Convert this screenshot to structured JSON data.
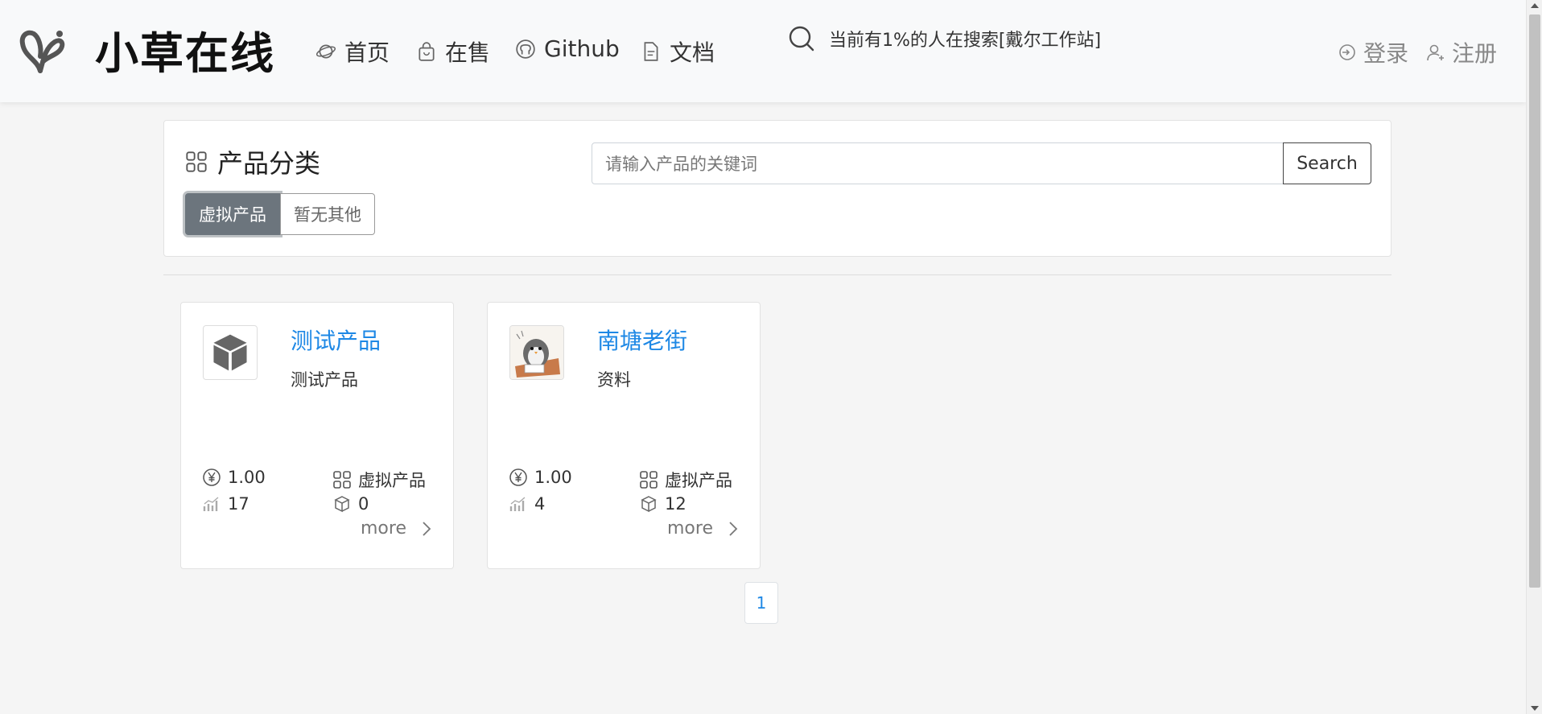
{
  "header": {
    "logo_text": "小草在线",
    "nav": [
      {
        "label": "首页",
        "icon": "planet-icon"
      },
      {
        "label": "在售",
        "icon": "bag-icon"
      },
      {
        "label": "Github",
        "icon": "github-icon"
      },
      {
        "label": "文档",
        "icon": "document-icon"
      }
    ],
    "search_hint": "当前有1%的人在搜索[戴尔工作站]",
    "login_label": "登录",
    "register_label": "注册"
  },
  "category": {
    "title": "产品分类",
    "buttons": [
      {
        "label": "虚拟产品",
        "active": true
      },
      {
        "label": "暂无其他",
        "active": false
      }
    ],
    "search_placeholder": "请输入产品的关键词",
    "search_button": "Search"
  },
  "products": [
    {
      "name": "测试产品",
      "description": "测试产品",
      "price": "1.00",
      "category": "虚拟产品",
      "sales": "17",
      "stock": "0",
      "more_label": "more",
      "thumb": "cube-icon"
    },
    {
      "name": "南塘老街",
      "description": "资料",
      "price": "1.00",
      "category": "虚拟产品",
      "sales": "4",
      "stock": "12",
      "more_label": "more",
      "thumb": "penguin-image"
    }
  ],
  "pagination": {
    "current": "1"
  },
  "colors": {
    "link": "#1e88e5",
    "active_button": "#6c757d",
    "background": "#f5f5f5"
  }
}
